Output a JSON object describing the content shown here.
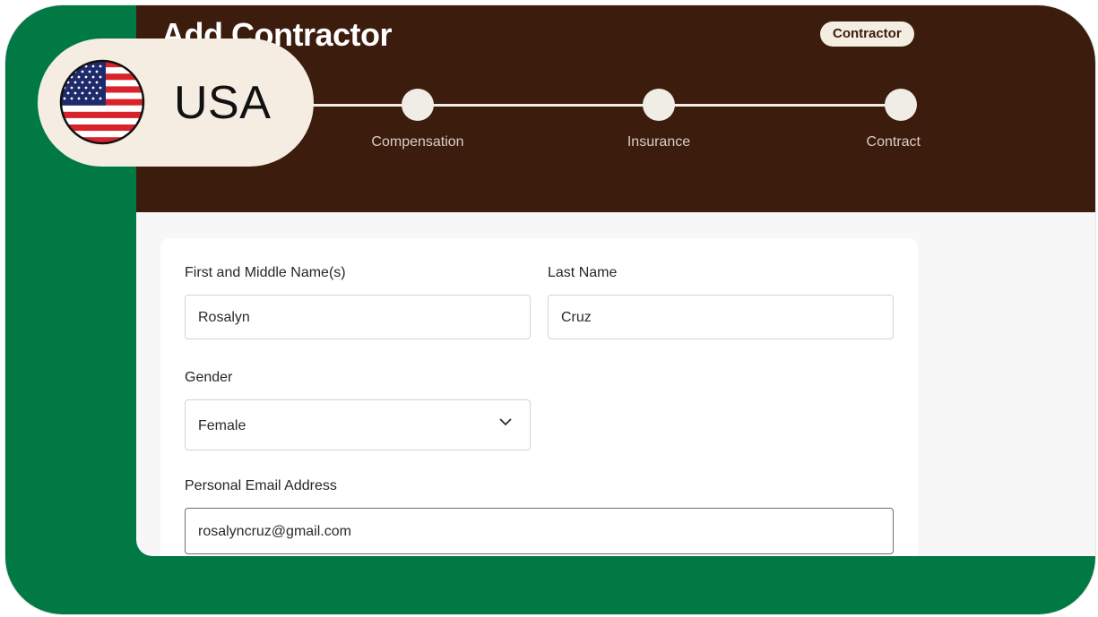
{
  "header": {
    "title": "Add Contractor",
    "badge": "Contractor"
  },
  "stepper": {
    "steps": [
      {
        "label": "Compensation"
      },
      {
        "label": "Insurance"
      },
      {
        "label": "Contract"
      }
    ]
  },
  "form": {
    "first_name": {
      "label": "First and Middle Name(s)",
      "value": "Rosalyn"
    },
    "last_name": {
      "label": "Last Name",
      "value": "Cruz"
    },
    "gender": {
      "label": "Gender",
      "value": "Female"
    },
    "email": {
      "label": "Personal Email Address",
      "value": "rosalyncruz@gmail.com"
    }
  },
  "country": {
    "name": "USA",
    "flag_icon": "us-flag-icon"
  },
  "colors": {
    "frame_green": "#017945",
    "header_brown": "#3c1c0c",
    "pill_cream": "#f5ede2"
  }
}
